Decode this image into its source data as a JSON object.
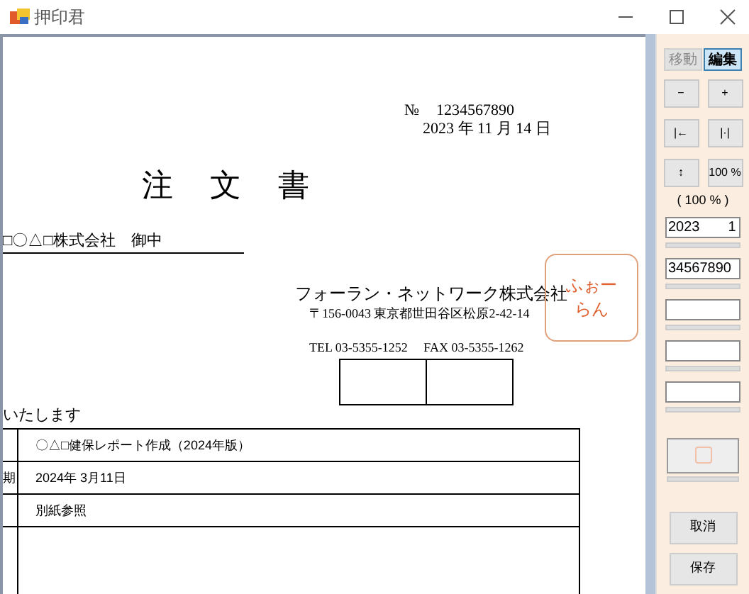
{
  "window": {
    "title": "押印君"
  },
  "document": {
    "number_label": "№",
    "number": "1234567890",
    "date": "2023 年 11 月 14 日",
    "title": "注 文 書",
    "recipient": "□〇△□株式会社　御中",
    "company": "フォーラン・ネットワーク株式会社",
    "address": "〒156-0043 東京都世田谷区松原2-42-14",
    "phone": "TEL 03-5355-1252　 FAX 03-5355-1262",
    "stamp_text": [
      "ふぉー",
      "らん"
    ],
    "lead_text": "いたします",
    "table": {
      "rows": [
        {
          "value": "〇△□健保レポート作成（2024年版）"
        },
        {
          "label": "期",
          "value": "2024年 3月11日"
        },
        {
          "value": "別紙参照"
        },
        {
          "kind": "blank"
        }
      ]
    }
  },
  "panel": {
    "tabs": [
      {
        "label": "移動",
        "selected": false
      },
      {
        "label": "編集",
        "selected": true
      }
    ],
    "buttons": [
      {
        "label": "−"
      },
      {
        "label": "+"
      },
      {
        "label": "|←"
      },
      {
        "label": "|·|"
      },
      {
        "label": "↕"
      },
      {
        "label": "100 %"
      }
    ],
    "zoom_label": "( 100 % )",
    "fields": [
      {
        "kind": "text",
        "value": "2023　　1"
      },
      {
        "kind": "text",
        "value": "34567890"
      },
      {
        "kind": "blank"
      },
      {
        "kind": "blank"
      },
      {
        "kind": "blank"
      }
    ],
    "cancel": "取消",
    "save": "保存"
  }
}
